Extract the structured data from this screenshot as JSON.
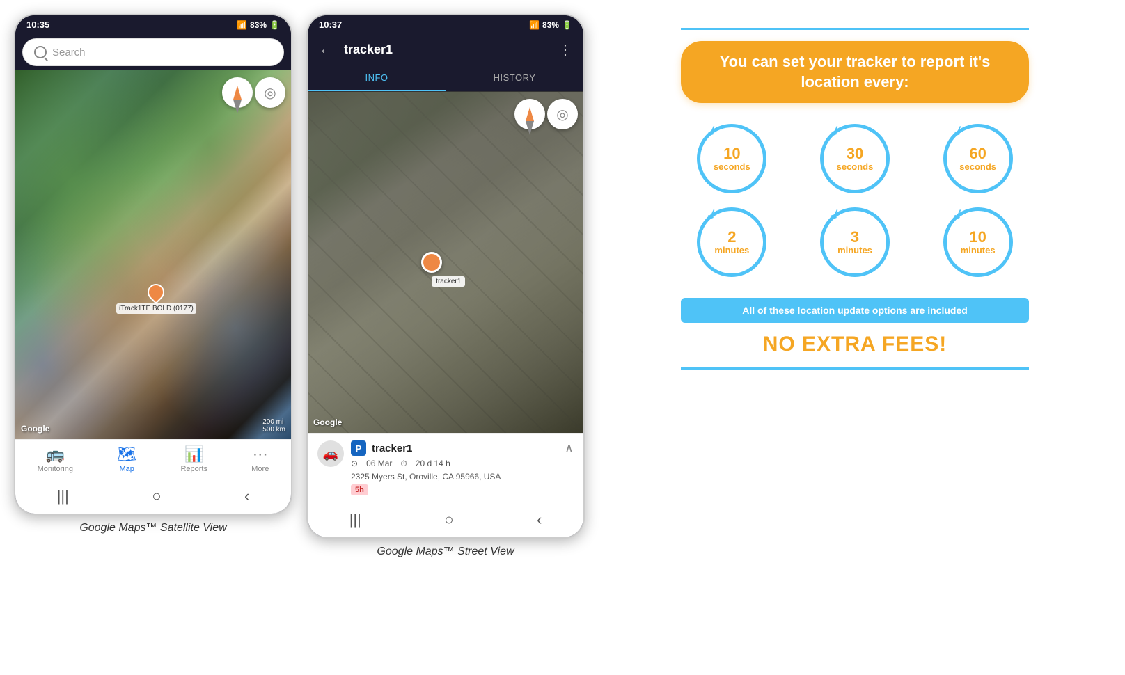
{
  "phone1": {
    "status_bar": {
      "time": "10:35",
      "signal": "▲▲▲",
      "battery": "83%"
    },
    "search_placeholder": "Search",
    "google_logo": "Google",
    "scale_label": "200 mi\n500 km",
    "marker_label": "iTrack1TE BOLD (0177)",
    "nav_items": [
      {
        "icon": "🚌",
        "label": "Monitoring",
        "active": false
      },
      {
        "icon": "🗺",
        "label": "Map",
        "active": true
      },
      {
        "icon": "📊",
        "label": "Reports",
        "active": false
      },
      {
        "icon": "•••",
        "label": "More",
        "active": false
      }
    ],
    "caption": "Google Maps™ Satellite View"
  },
  "phone2": {
    "status_bar": {
      "time": "10:37",
      "signal": "▲▲▲",
      "battery": "83%"
    },
    "title": "tracker1",
    "tabs": [
      {
        "label": "INFO",
        "active": true
      },
      {
        "label": "HISTORY",
        "active": false
      }
    ],
    "google_logo": "Google",
    "tracker_info": {
      "name": "tracker1",
      "parking_label": "P",
      "date": "06 Mar",
      "duration": "20 d 14 h",
      "address": "2325 Myers St, Oroville, CA 95966, USA",
      "badge": "5h"
    },
    "caption": "Google Maps™ Street View"
  },
  "info_panel": {
    "header": "You can set your tracker\nto report it's location every:",
    "intervals": [
      {
        "number": "10",
        "unit": "seconds"
      },
      {
        "number": "30",
        "unit": "seconds"
      },
      {
        "number": "60",
        "unit": "seconds"
      },
      {
        "number": "2",
        "unit": "minutes"
      },
      {
        "number": "3",
        "unit": "minutes"
      },
      {
        "number": "10",
        "unit": "minutes"
      }
    ],
    "no_fee_label": "All of these location update options are included",
    "no_extra_fees": "NO EXTRA FEES!"
  }
}
